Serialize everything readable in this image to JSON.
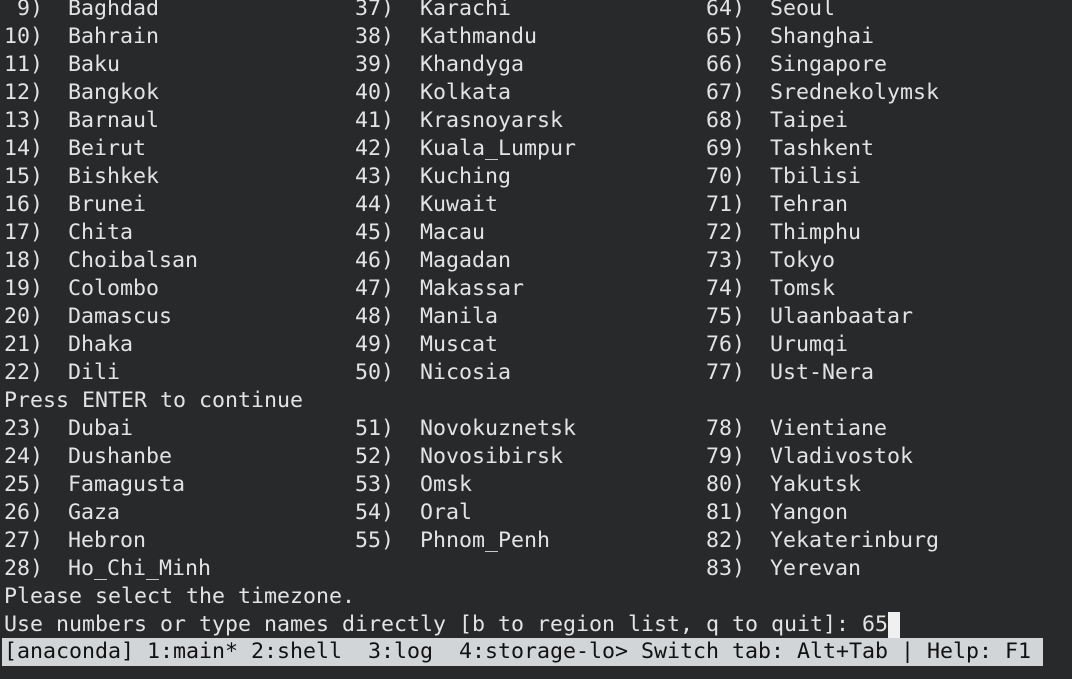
{
  "terminal": {
    "block1": [
      [
        {
          "num": " 9)",
          "name": "Baghdad"
        },
        {
          "num": "37)",
          "name": "Karachi"
        },
        {
          "num": "64)",
          "name": "Seoul"
        }
      ],
      [
        {
          "num": "10)",
          "name": "Bahrain"
        },
        {
          "num": "38)",
          "name": "Kathmandu"
        },
        {
          "num": "65)",
          "name": "Shanghai"
        }
      ],
      [
        {
          "num": "11)",
          "name": "Baku"
        },
        {
          "num": "39)",
          "name": "Khandyga"
        },
        {
          "num": "66)",
          "name": "Singapore"
        }
      ],
      [
        {
          "num": "12)",
          "name": "Bangkok"
        },
        {
          "num": "40)",
          "name": "Kolkata"
        },
        {
          "num": "67)",
          "name": "Srednekolymsk"
        }
      ],
      [
        {
          "num": "13)",
          "name": "Barnaul"
        },
        {
          "num": "41)",
          "name": "Krasnoyarsk"
        },
        {
          "num": "68)",
          "name": "Taipei"
        }
      ],
      [
        {
          "num": "14)",
          "name": "Beirut"
        },
        {
          "num": "42)",
          "name": "Kuala_Lumpur"
        },
        {
          "num": "69)",
          "name": "Tashkent"
        }
      ],
      [
        {
          "num": "15)",
          "name": "Bishkek"
        },
        {
          "num": "43)",
          "name": "Kuching"
        },
        {
          "num": "70)",
          "name": "Tbilisi"
        }
      ],
      [
        {
          "num": "16)",
          "name": "Brunei"
        },
        {
          "num": "44)",
          "name": "Kuwait"
        },
        {
          "num": "71)",
          "name": "Tehran"
        }
      ],
      [
        {
          "num": "17)",
          "name": "Chita"
        },
        {
          "num": "45)",
          "name": "Macau"
        },
        {
          "num": "72)",
          "name": "Thimphu"
        }
      ],
      [
        {
          "num": "18)",
          "name": "Choibalsan"
        },
        {
          "num": "46)",
          "name": "Magadan"
        },
        {
          "num": "73)",
          "name": "Tokyo"
        }
      ],
      [
        {
          "num": "19)",
          "name": "Colombo"
        },
        {
          "num": "47)",
          "name": "Makassar"
        },
        {
          "num": "74)",
          "name": "Tomsk"
        }
      ],
      [
        {
          "num": "20)",
          "name": "Damascus"
        },
        {
          "num": "48)",
          "name": "Manila"
        },
        {
          "num": "75)",
          "name": "Ulaanbaatar"
        }
      ],
      [
        {
          "num": "21)",
          "name": "Dhaka"
        },
        {
          "num": "49)",
          "name": "Muscat"
        },
        {
          "num": "76)",
          "name": "Urumqi"
        }
      ],
      [
        {
          "num": "22)",
          "name": "Dili"
        },
        {
          "num": "50)",
          "name": "Nicosia"
        },
        {
          "num": "77)",
          "name": "Ust-Nera"
        }
      ]
    ],
    "press_enter": "Press ENTER to continue",
    "block2": [
      [
        {
          "num": "23)",
          "name": "Dubai"
        },
        {
          "num": "51)",
          "name": "Novokuznetsk"
        },
        {
          "num": "78)",
          "name": "Vientiane"
        }
      ],
      [
        {
          "num": "24)",
          "name": "Dushanbe"
        },
        {
          "num": "52)",
          "name": "Novosibirsk"
        },
        {
          "num": "79)",
          "name": "Vladivostok"
        }
      ],
      [
        {
          "num": "25)",
          "name": "Famagusta"
        },
        {
          "num": "53)",
          "name": "Omsk"
        },
        {
          "num": "80)",
          "name": "Yakutsk"
        }
      ],
      [
        {
          "num": "26)",
          "name": "Gaza"
        },
        {
          "num": "54)",
          "name": "Oral"
        },
        {
          "num": "81)",
          "name": "Yangon"
        }
      ],
      [
        {
          "num": "27)",
          "name": "Hebron"
        },
        {
          "num": "55)",
          "name": "Phnom_Penh"
        },
        {
          "num": "82)",
          "name": "Yekaterinburg"
        }
      ],
      [
        {
          "num": "28)",
          "name": "Ho_Chi_Minh"
        },
        null,
        {
          "num": "83)",
          "name": "Yerevan"
        }
      ]
    ],
    "select_prompt": "Please select the timezone.",
    "input_prompt": "Use numbers or type names directly [b to region list, q to quit]: ",
    "input_value": "65"
  },
  "status_bar": {
    "text": "[anaconda] 1:main* 2:shell  3:log  4:storage-lo> Switch tab: Alt+Tab | Help: F1"
  },
  "colors": {
    "background": "#27292b",
    "text": "#e3e3e3",
    "status_bg": "#d2d5d7"
  }
}
